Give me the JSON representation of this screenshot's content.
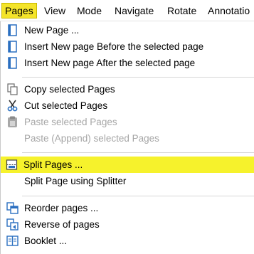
{
  "menubar": {
    "items": [
      {
        "label": "Pages"
      },
      {
        "label": "View"
      },
      {
        "label": "Mode"
      },
      {
        "label": "Navigate"
      },
      {
        "label": "Rotate"
      },
      {
        "label": "Annotatio"
      }
    ]
  },
  "menu": {
    "items": [
      {
        "label": "New Page ...",
        "icon": "new-page-icon",
        "enabled": true
      },
      {
        "label": "Insert New page Before the selected page",
        "icon": "insert-before-icon",
        "enabled": true
      },
      {
        "label": "Insert New page After the selected page",
        "icon": "insert-after-icon",
        "enabled": true
      },
      {
        "label": "Copy selected Pages",
        "icon": "copy-icon",
        "enabled": true
      },
      {
        "label": "Cut selected Pages",
        "icon": "scissors-icon",
        "enabled": true
      },
      {
        "label": "Paste selected Pages",
        "icon": "paste-icon",
        "enabled": false
      },
      {
        "label": "Paste (Append) selected Pages",
        "icon": "",
        "enabled": false
      },
      {
        "label": "Split Pages ...",
        "icon": "split-icon",
        "enabled": true,
        "highlighted": true
      },
      {
        "label": "Split Page using Splitter",
        "icon": "",
        "enabled": true
      },
      {
        "label": "Reorder pages ...",
        "icon": "reorder-icon",
        "enabled": true
      },
      {
        "label": "Reverse of pages",
        "icon": "reverse-icon",
        "enabled": true
      },
      {
        "label": "Booklet ...",
        "icon": "booklet-icon",
        "enabled": true
      }
    ]
  },
  "colors": {
    "highlight": "#f6f22c",
    "active_menu": "#f4e42a",
    "icon_blue": "#2a6fc0",
    "disabled_text": "#a6a6a6"
  }
}
